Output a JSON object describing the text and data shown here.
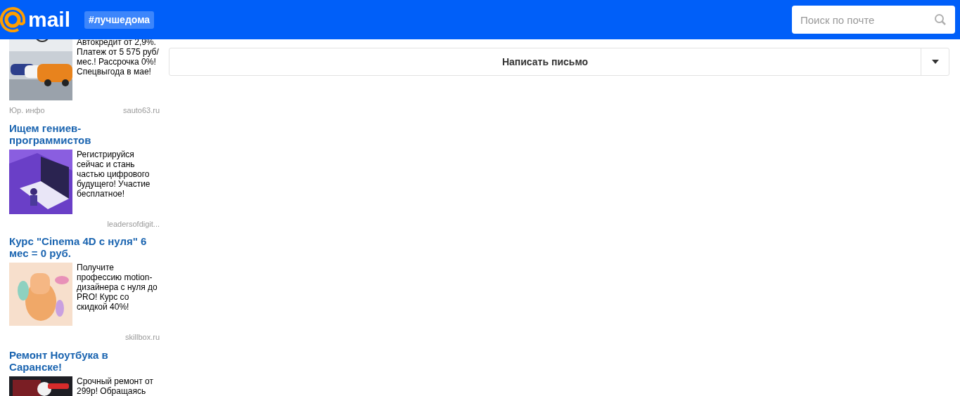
{
  "header": {
    "logo": "mail",
    "hashtag": "#лучшедома",
    "search": {
      "placeholder": "Поиск по почте"
    }
  },
  "ads": [
    {
      "text": "Автокредит от 2,9%. Платеж от 5 575 руб/ мес.! Рассрочка 0%! Спецвыгода в мае!",
      "label": "Юр. инфо",
      "source": "sauto63.ru",
      "kind": "cars"
    },
    {
      "title": "Ищем гениев-программистов",
      "text": "Регистрируйся сейчас и стань частью цифрового будущего! Участие бесплатное!",
      "source": "leadersofdigit...",
      "kind": "laptop"
    },
    {
      "title": "Курс \"Cinema 4D с нуля\" 6 мес = 0 руб.",
      "text": "Получите профессию motion-дизайнера с нуля до PRO! Курс со скидкой 40%!",
      "source": "skillbox.ru",
      "kind": "hand"
    },
    {
      "title": "Ремонт Ноутбука в Саранске!",
      "text": "Срочный ремонт от 299р! Обращаясь",
      "kind": "repair"
    }
  ],
  "compose": {
    "label": "Написать письмо"
  }
}
